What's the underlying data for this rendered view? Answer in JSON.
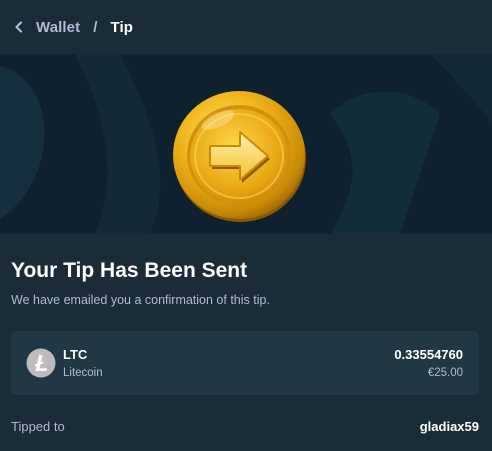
{
  "breadcrumb": {
    "back_icon": "chevron-left-icon",
    "wallet_label": "Wallet",
    "separator": "/",
    "current_label": "Tip"
  },
  "banner": {
    "image": "gold-coin-arrow-icon"
  },
  "main": {
    "title": "Your Tip Has Been Sent",
    "subtitle": "We have emailed you a confirmation of this tip."
  },
  "currency": {
    "icon": "litecoin-icon",
    "code": "LTC",
    "name": "Litecoin",
    "amount": "0.33554760",
    "fiat": "€25.00"
  },
  "recipient": {
    "label": "Tipped to",
    "username": "gladiax59"
  },
  "colors": {
    "background": "#1a2c38",
    "banner": "#0f212e",
    "card": "#213743",
    "muted_text": "#b1bad3",
    "text": "#ffffff",
    "coin_gold": "#e8b11f"
  }
}
